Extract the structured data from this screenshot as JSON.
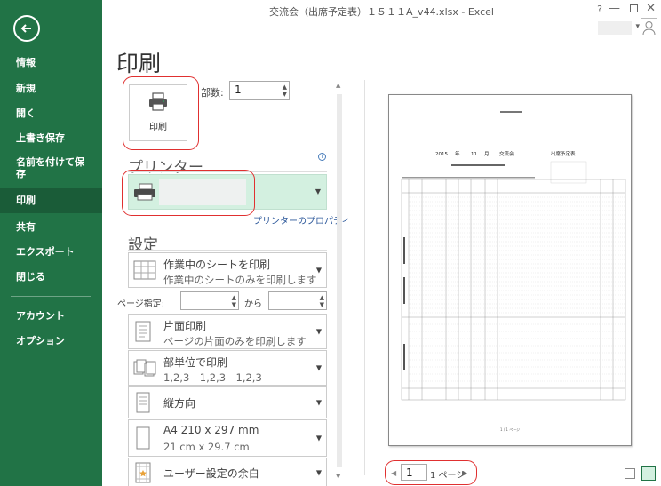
{
  "window": {
    "title": "交流会（出席予定表）１５１１A_v44.xlsx - Excel",
    "help": "?",
    "minimize": "—",
    "close": "✕"
  },
  "sidebar": {
    "back_icon": "back-arrow-icon",
    "items": [
      {
        "label": "情報"
      },
      {
        "label": "新規"
      },
      {
        "label": "開く"
      },
      {
        "label": "上書き保存"
      },
      {
        "label": "名前を付けて保存"
      },
      {
        "label": "印刷",
        "active": true
      },
      {
        "label": "共有"
      },
      {
        "label": "エクスポート"
      },
      {
        "label": "閉じる"
      },
      {
        "label": "アカウント"
      },
      {
        "label": "オプション"
      }
    ]
  },
  "main": {
    "title": "印刷",
    "print_button": {
      "label": "印刷",
      "icon": "printer-icon"
    },
    "copies": {
      "label": "部数:",
      "value": "1"
    },
    "printer_section": {
      "heading": "プリンター",
      "info_icon": "info-icon",
      "properties_link": "プリンターのプロパティ"
    },
    "settings_section": {
      "heading": "設定"
    },
    "settings": [
      {
        "main": "作業中のシートを印刷",
        "sub": "作業中のシートのみを印刷します",
        "icon": "sheet-grid-icon"
      },
      {
        "main": "片面印刷",
        "sub": "ページの片面のみを印刷します",
        "icon": "single-sided-icon"
      },
      {
        "main": "部単位で印刷",
        "sub": "1,2,3　1,2,3　1,2,3",
        "icon": "collated-icon"
      },
      {
        "main": "縦方向",
        "sub": "",
        "icon": "portrait-icon"
      },
      {
        "main": "A4 210 x 297 mm",
        "sub": "21 cm x 29.7 cm",
        "icon": "paper-size-icon"
      },
      {
        "main": "ユーザー設定の余白",
        "sub": "",
        "icon": "custom-margins-icon"
      }
    ],
    "pages": {
      "label": "ページ指定:",
      "to": "から"
    }
  },
  "preview": {
    "nav": {
      "current": "1",
      "total": "1 ページ"
    },
    "sheet": {
      "header_year": "2015",
      "header_year_unit": "年",
      "header_month": "11",
      "header_month_unit": "月",
      "header_event": "交流会",
      "header_right": "出席予定表",
      "footer": "1 / 1 ページ"
    }
  },
  "colors": {
    "accent": "#217346",
    "annotation": "#e03030",
    "printer_bg": "#d3f0e0",
    "link": "#2b579a"
  }
}
